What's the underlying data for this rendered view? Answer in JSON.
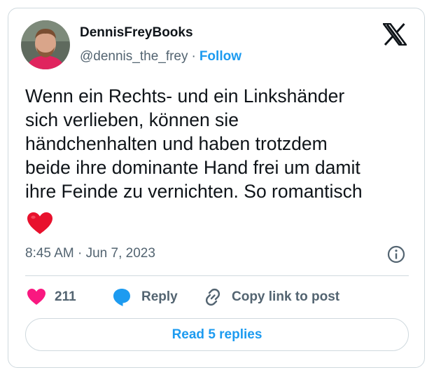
{
  "author": {
    "display_name": "DennisFreyBooks",
    "handle": "@dennis_the_frey",
    "separator": "·",
    "follow_label": "Follow"
  },
  "tweet": {
    "text": "Wenn ein Rechts- und ein Linkshänder\nsich verlieben, können sie\nhändchenhalten und haben trotzdem\nbeide ihre dominante Hand frei um damit\nihre Feinde zu vernichten. So romantisch",
    "emoji": "red-heart",
    "timestamp": "8:45 AM · Jun 7, 2023"
  },
  "actions": {
    "like_count": "211",
    "reply_label": "Reply",
    "copy_link_label": "Copy link to post"
  },
  "footer": {
    "read_replies_label": "Read 5 replies"
  },
  "colors": {
    "accent": "#1d9bf0",
    "like_pink": "#f91880",
    "text_primary": "#0f1419",
    "text_secondary": "#536471",
    "border": "#cfd9de",
    "heart_red": "#e8112d"
  }
}
